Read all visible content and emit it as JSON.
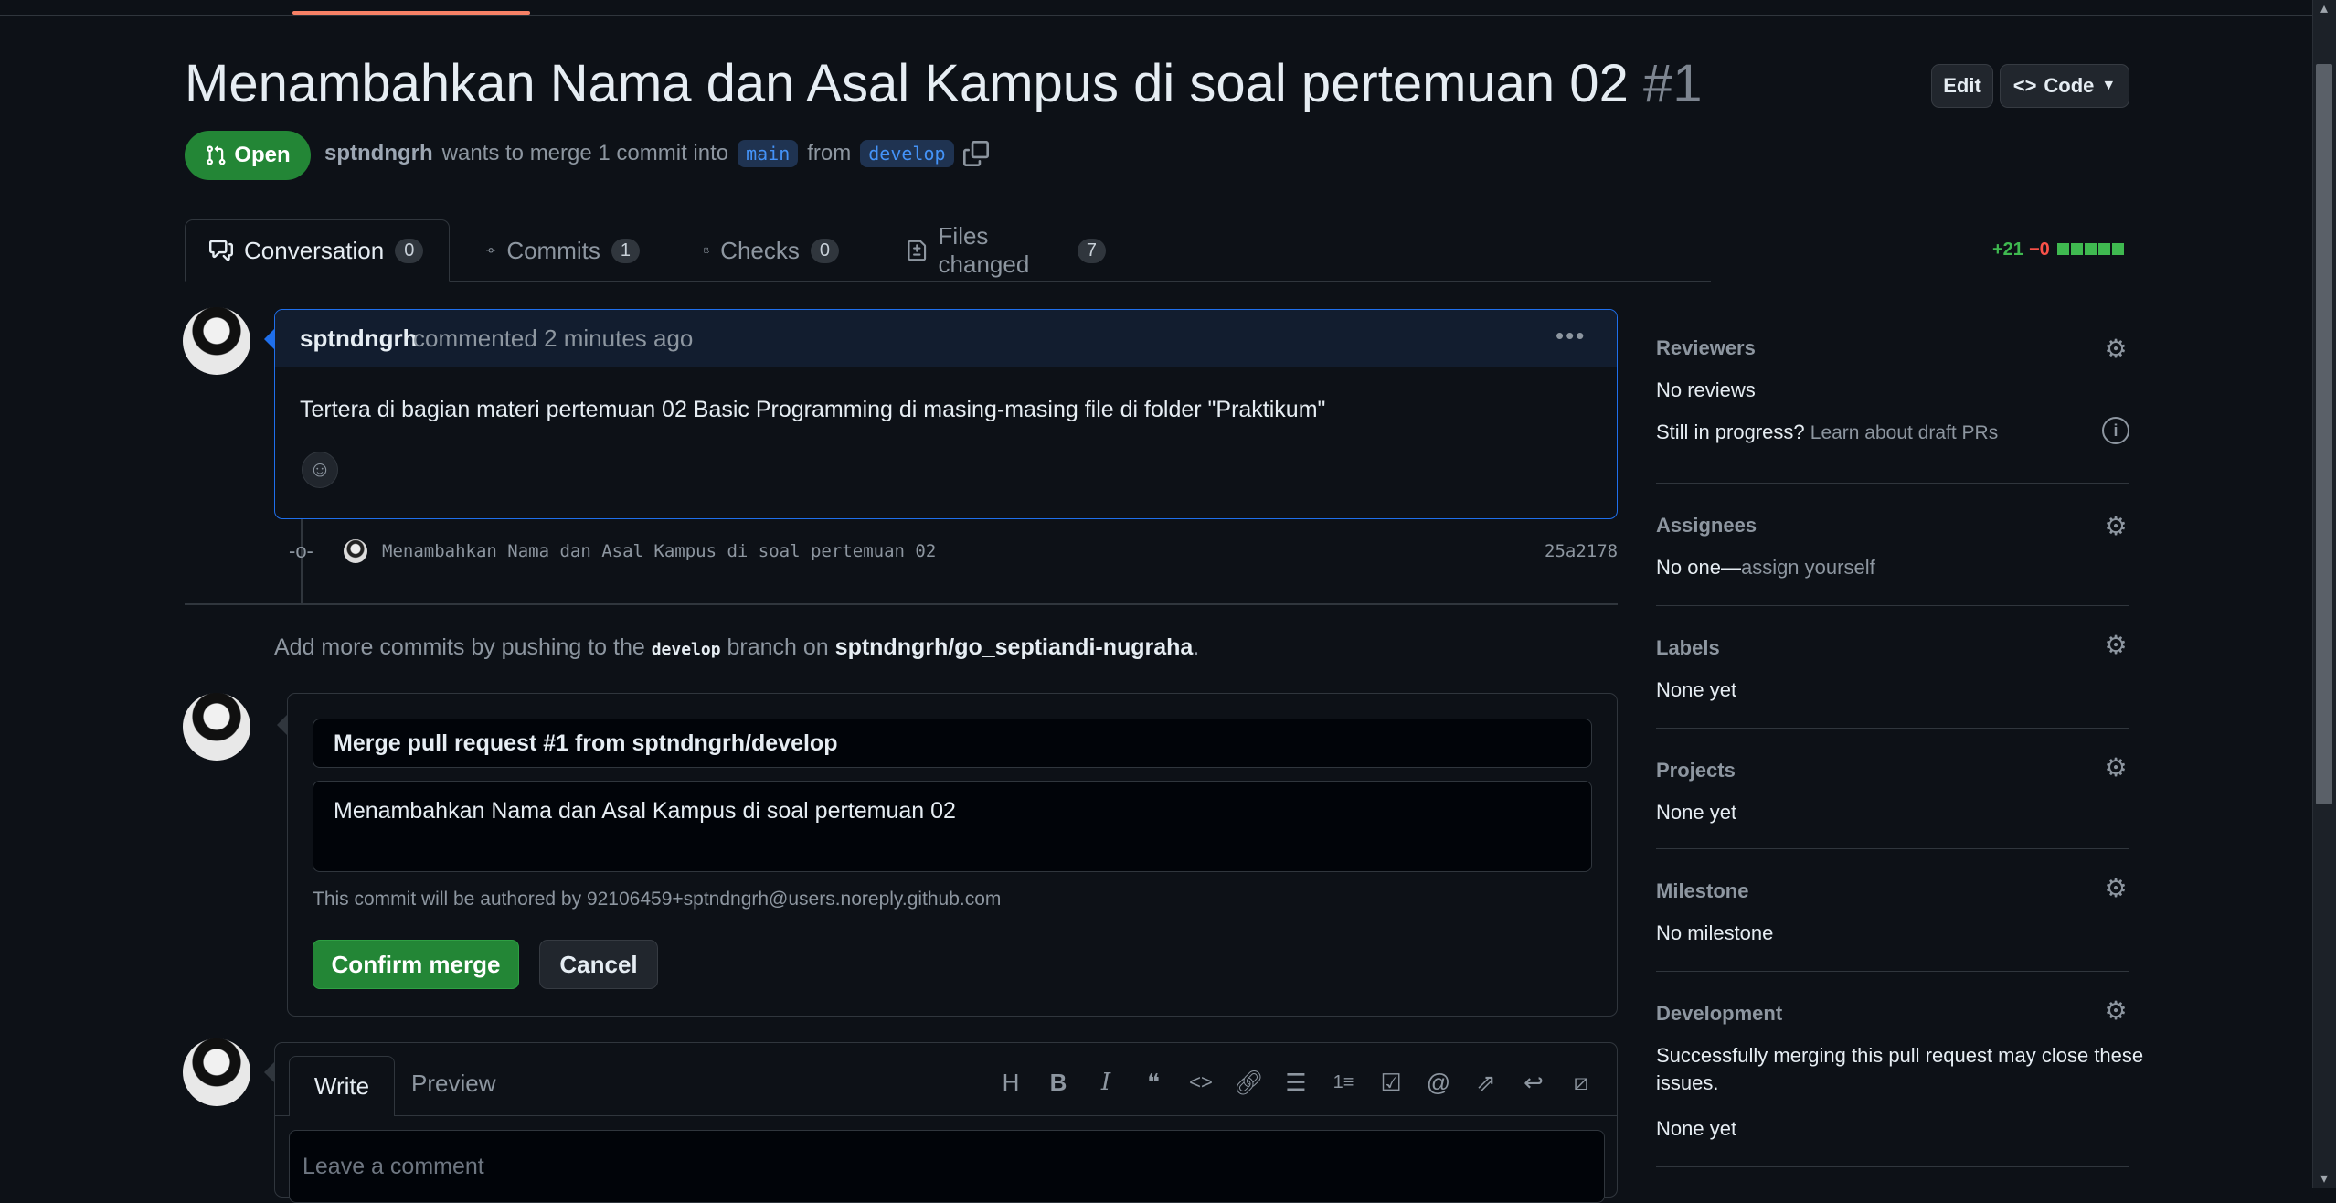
{
  "header": {
    "title": "Menambahkan Nama dan Asal Kampus di soal pertemuan 02",
    "number": "#1",
    "edit_label": "Edit",
    "code_label": "Code",
    "state_label": "Open",
    "author": "sptndngrh",
    "merge_text": "wants to merge 1 commit into",
    "base_branch": "main",
    "from_text": "from",
    "head_branch": "develop"
  },
  "tabs": [
    {
      "label": "Conversation",
      "count": "0"
    },
    {
      "label": "Commits",
      "count": "1"
    },
    {
      "label": "Checks",
      "count": "0"
    },
    {
      "label": "Files changed",
      "count": "7"
    }
  ],
  "diffstat": {
    "additions": "+21",
    "deletions": "−0"
  },
  "comment": {
    "author": "sptndngrh",
    "meta": "commented 2 minutes ago",
    "body": "Tertera di bagian materi pertemuan 02 Basic Programming di masing-masing file di folder \"Praktikum\""
  },
  "commit": {
    "message": "Menambahkan Nama dan Asal Kampus di soal pertemuan 02",
    "sha": "25a2178"
  },
  "push_hint": {
    "prefix": "Add more commits by pushing to the",
    "branch": "develop",
    "middle": "branch on",
    "repo": "sptndngrh/go_septiandi-nugraha",
    "suffix": "."
  },
  "merge_form": {
    "title_value": "Merge pull request #1 from sptndngrh/develop",
    "body_value": "Menambahkan Nama dan Asal Kampus di soal pertemuan 02",
    "author_note": "This commit will be authored by 92106459+sptndngrh@users.noreply.github.com",
    "confirm_label": "Confirm merge",
    "cancel_label": "Cancel"
  },
  "new_comment": {
    "write_label": "Write",
    "preview_label": "Preview",
    "placeholder": "Leave a comment"
  },
  "sidebar": {
    "reviewers": {
      "title": "Reviewers",
      "value": "No reviews",
      "draft_q": "Still in progress?",
      "draft_link": "Learn about draft PRs"
    },
    "assignees": {
      "title": "Assignees",
      "value": "No one—",
      "link": "assign yourself"
    },
    "labels": {
      "title": "Labels",
      "value": "None yet"
    },
    "projects": {
      "title": "Projects",
      "value": "None yet"
    },
    "milestone": {
      "title": "Milestone",
      "value": "No milestone"
    },
    "development": {
      "title": "Development",
      "desc_1": "Successfully merging this pull request may close these",
      "desc_2": "issues.",
      "value": "None yet"
    }
  },
  "colors": {
    "accent": "#1f6feb",
    "success": "#238636",
    "background": "#0d1117"
  }
}
